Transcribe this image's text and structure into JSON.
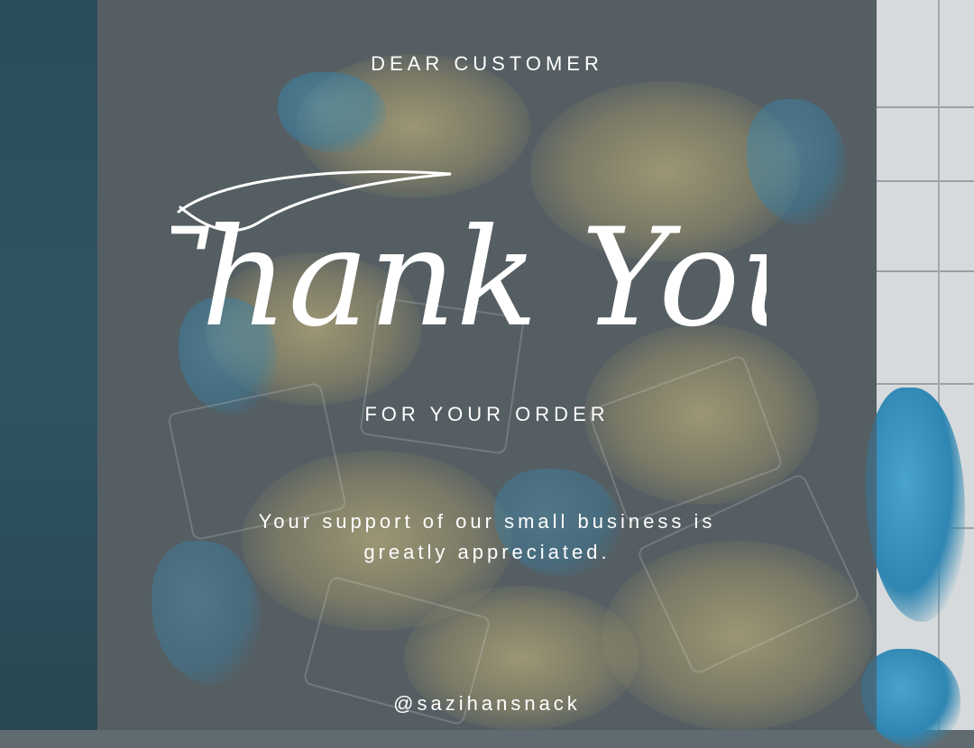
{
  "card": {
    "greeting": "DEAR CUSTOMER",
    "headline": "Thank You",
    "subheadline": "FOR YOUR ORDER",
    "message_line1": "Your support of our small business is",
    "message_line2": "greatly appreciated.",
    "handle": "@sazihansnack"
  },
  "colors": {
    "text": "#ffffff",
    "overlay": "#4e5458",
    "accent_blue": "#2f86b2",
    "left_strip": "#2f5563"
  }
}
